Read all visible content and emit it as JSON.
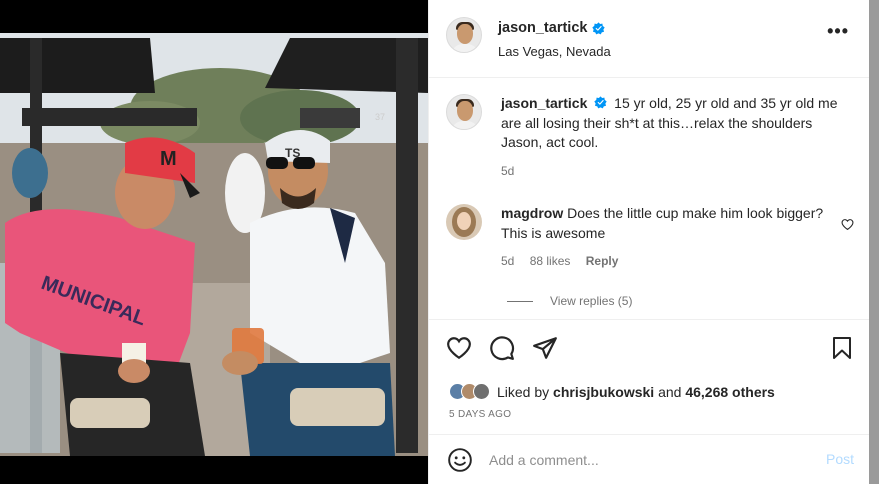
{
  "post": {
    "username": "jason_tartick",
    "location": "Las Vegas, Nevada",
    "more_label": "•••"
  },
  "caption": {
    "username": "jason_tartick",
    "text": "15 yr old, 25 yr old and 35 yr old me are all losing their sh*t at this…relax the shoulders Jason, act cool.",
    "age": "5d"
  },
  "comment": {
    "username": "magdrow",
    "text": "Does the little cup make him look bigger? This is awesome",
    "age": "5d",
    "likes": "88 likes",
    "reply_label": "Reply"
  },
  "view_replies": "View replies (5)",
  "likes_line": {
    "prefix": "Liked by",
    "user": "chrisjbukowski",
    "conj": "and",
    "others": "46,268 others"
  },
  "date": "5 DAYS AGO",
  "add_comment": {
    "placeholder": "Add a comment...",
    "post_label": "Post"
  },
  "photo": {
    "hat_letter": "M",
    "hoodie_text": "MUNICIPAL",
    "cap_text": "TS",
    "cart_number": "37"
  },
  "colors": {
    "verified": "#0095f6",
    "post_button": "#b3dbff",
    "secondary_text": "#737373"
  }
}
